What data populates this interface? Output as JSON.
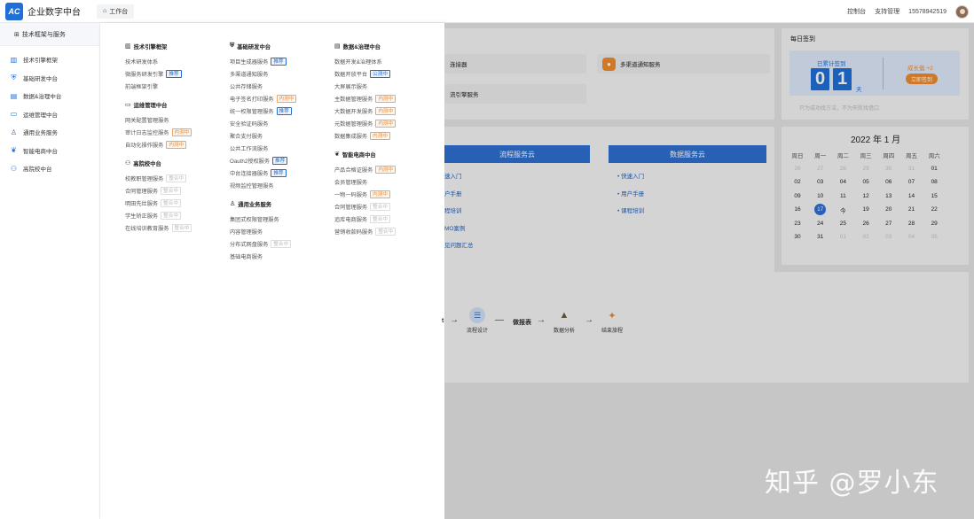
{
  "header": {
    "logo_text": "AC",
    "app_title": "企业数字中台",
    "workbench_tab": "工作台",
    "right_links": [
      "控制台",
      "支持管理",
      "15578942519"
    ],
    "accent": "#1f6fd6"
  },
  "sidebar": {
    "top_label": "技术框架与服务",
    "items": [
      {
        "label": "技术引擎框架",
        "icon": "chart-bar-icon"
      },
      {
        "label": "基础研发中台",
        "icon": "shield-icon"
      },
      {
        "label": "数据&治理中台",
        "icon": "database-icon"
      },
      {
        "label": "运维管理中台",
        "icon": "monitor-icon"
      },
      {
        "label": "通用业务服务",
        "icon": "user-icon"
      },
      {
        "label": "智能电商中台",
        "icon": "leaf-icon"
      },
      {
        "label": "高院校中台",
        "icon": "people-icon"
      }
    ]
  },
  "mega_menu": {
    "col1": [
      {
        "title": "技术引擎框架",
        "icon": "chart-bar-icon",
        "items": [
          {
            "label": "技术研发体系",
            "tag": ""
          },
          {
            "label": "微服务研发引擎",
            "tag": "推荐",
            "tag_type": "blue"
          },
          {
            "label": "前端框架引擎",
            "tag": ""
          }
        ]
      },
      {
        "title": "运维管理中台",
        "icon": "monitor-icon",
        "items": [
          {
            "label": "网关配置管理服务",
            "tag": ""
          },
          {
            "label": "审计日志监控服务",
            "tag": "内测中",
            "tag_type": "orange"
          },
          {
            "label": "自动化操作服务",
            "tag": "内测中",
            "tag_type": "orange"
          }
        ]
      },
      {
        "title": "高院校中台",
        "icon": "people-icon",
        "items": [
          {
            "label": "校教职管理服务",
            "tag": "整合中",
            "tag_type": "gray"
          },
          {
            "label": "合同管理服务",
            "tag": "整合中",
            "tag_type": "gray"
          },
          {
            "label": "明田先灶服务",
            "tag": "整合中",
            "tag_type": "gray"
          },
          {
            "label": "学生矫正服务",
            "tag": "整合中",
            "tag_type": "gray"
          },
          {
            "label": "在线培训教育服务",
            "tag": "整合中",
            "tag_type": "gray"
          }
        ]
      }
    ],
    "col2": [
      {
        "title": "基础研发中台",
        "icon": "shield-icon",
        "items": [
          {
            "label": "项目生成器服务",
            "tag": "推荐",
            "tag_type": "blue"
          },
          {
            "label": "多渠道通知服务",
            "tag": ""
          },
          {
            "label": "公共存储服务",
            "tag": ""
          },
          {
            "label": "电子签名打印服务",
            "tag": "内测中",
            "tag_type": "orange"
          },
          {
            "label": "统一权限管理服务",
            "tag": "推荐",
            "tag_type": "blue"
          },
          {
            "label": "安全验证码服务",
            "tag": ""
          },
          {
            "label": "聚合支付服务",
            "tag": ""
          },
          {
            "label": "公共工作流服务",
            "tag": ""
          },
          {
            "label": "Oauth2授权服务",
            "tag": "推荐",
            "tag_type": "blue"
          },
          {
            "label": "中台连接器服务",
            "tag": "推荐",
            "tag_type": "blue"
          },
          {
            "label": "视频监控管理服务",
            "tag": ""
          }
        ]
      },
      {
        "title": "通用业务服务",
        "icon": "user-icon",
        "items": [
          {
            "label": "集团式权限管理服务",
            "tag": ""
          },
          {
            "label": "内容管理服务",
            "tag": ""
          },
          {
            "label": "分布式网盘服务",
            "tag": "整合中",
            "tag_type": "gray"
          },
          {
            "label": "基础电商服务",
            "tag": ""
          }
        ]
      }
    ],
    "col3": [
      {
        "title": "数据&治理中台",
        "icon": "database-icon",
        "items": [
          {
            "label": "数据开发&治理体系",
            "tag": ""
          },
          {
            "label": "数据开放平台",
            "tag": "公测中",
            "tag_type": "blue"
          },
          {
            "label": "大屏展示服务",
            "tag": ""
          },
          {
            "label": "主数据管理服务",
            "tag": "内测中",
            "tag_type": "orange"
          },
          {
            "label": "大数据开发服务",
            "tag": "内测中",
            "tag_type": "orange"
          },
          {
            "label": "元数据管理服务",
            "tag": "内测中",
            "tag_type": "orange"
          },
          {
            "label": "数据集成服务",
            "tag": "内测中",
            "tag_type": "orange"
          }
        ]
      },
      {
        "title": "智能电商中台",
        "icon": "leaf-icon",
        "items": [
          {
            "label": "产品合格证服务",
            "tag": "内测中",
            "tag_type": "orange"
          },
          {
            "label": "会员管理服务",
            "tag": ""
          },
          {
            "label": "一物一码服务",
            "tag": "内测中",
            "tag_type": "orange"
          },
          {
            "label": "合同管理服务",
            "tag": "整合中",
            "tag_type": "gray"
          },
          {
            "label": "追库电商服务",
            "tag": "整合中",
            "tag_type": "gray"
          },
          {
            "label": "营销收款码服务",
            "tag": "整合中",
            "tag_type": "gray"
          }
        ]
      }
    ]
  },
  "services": {
    "left_a": "连接器",
    "left_b": "流引擎服务",
    "right_a": "多渠道通知服务"
  },
  "docs": {
    "flow_cloud": {
      "title": "流程服务云",
      "links": [
        "速入门",
        "户手册",
        "程培训",
        "MO案例",
        "见问题汇总"
      ]
    },
    "data_cloud": {
      "title": "数据服务云",
      "links": [
        "快速入门",
        "用户手册",
        "课程培训"
      ]
    }
  },
  "checkin": {
    "title": "每日签到",
    "label": "已累计签到",
    "digits": [
      "0",
      "1"
    ],
    "unit": "天",
    "growth": "成长值 +2",
    "button": "立即签到",
    "hint": "只为成功找方法，不为失败找借口"
  },
  "calendar": {
    "title": "2022 年 1 月",
    "weekdays": [
      "周日",
      "周一",
      "周二",
      "周三",
      "周四",
      "周五",
      "周六"
    ],
    "rows": [
      [
        "26",
        "27",
        "28",
        "29",
        "30",
        "31",
        "01"
      ],
      [
        "02",
        "03",
        "04",
        "05",
        "06",
        "07",
        "08"
      ],
      [
        "09",
        "10",
        "11",
        "12",
        "13",
        "14",
        "15"
      ],
      [
        "16",
        "17",
        "今",
        "19",
        "20",
        "21",
        "22"
      ],
      [
        "23",
        "24",
        "25",
        "26",
        "27",
        "28",
        "29"
      ],
      [
        "30",
        "31",
        "01",
        "02",
        "03",
        "04",
        "05"
      ]
    ],
    "muted": [
      [
        0,
        0
      ],
      [
        0,
        1
      ],
      [
        0,
        2
      ],
      [
        0,
        3
      ],
      [
        0,
        4
      ],
      [
        0,
        5
      ],
      [
        5,
        2
      ],
      [
        5,
        3
      ],
      [
        5,
        4
      ],
      [
        5,
        5
      ],
      [
        5,
        6
      ]
    ],
    "today": [
      3,
      1
    ]
  },
  "flow": {
    "steps": [
      {
        "type": "text",
        "label": "t"
      },
      {
        "type": "node",
        "label": "流程设计",
        "icon": "layers-icon"
      },
      {
        "type": "text",
        "label": "做报表"
      },
      {
        "type": "node",
        "label": "数据分析",
        "icon": "rocket-icon"
      },
      {
        "type": "node",
        "label": "结束旅程",
        "icon": "flag-icon"
      }
    ]
  },
  "watermark": "知乎 @罗小东"
}
